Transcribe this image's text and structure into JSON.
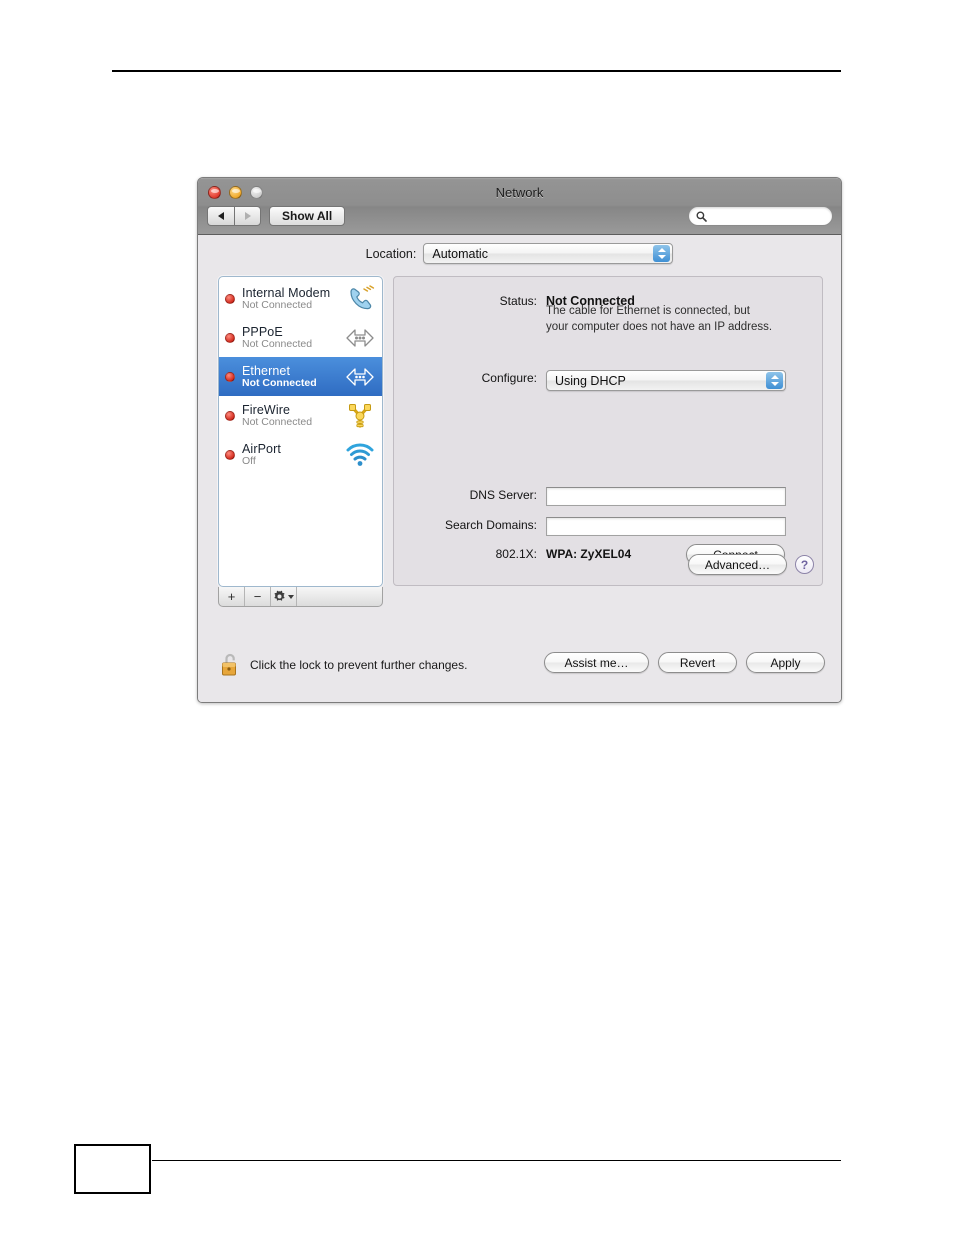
{
  "window": {
    "title": "Network",
    "traffic_lights": [
      "close-button",
      "minimize-button",
      "zoom-button"
    ],
    "toolbar": {
      "back_icon": "back-arrow-icon",
      "forward_icon": "forward-arrow-icon",
      "show_all_label": "Show All",
      "search_placeholder": "",
      "search_value": "",
      "search_icon": "search-icon"
    }
  },
  "location": {
    "label": "Location:",
    "value": "Automatic"
  },
  "sidebar": {
    "services": [
      {
        "name": "Internal Modem",
        "status": "Not Connected",
        "icon": "modem-icon",
        "selected": false
      },
      {
        "name": "PPPoE",
        "status": "Not Connected",
        "icon": "pppoe-icon",
        "selected": false
      },
      {
        "name": "Ethernet",
        "status": "Not Connected",
        "icon": "ethernet-icon",
        "selected": true
      },
      {
        "name": "FireWire",
        "status": "Not Connected",
        "icon": "firewire-icon",
        "selected": false
      },
      {
        "name": "AirPort",
        "status": "Off",
        "icon": "airport-icon",
        "selected": false
      }
    ],
    "toolbar": {
      "add_label": "+",
      "remove_label": "−",
      "action_icon": "gear-icon"
    }
  },
  "panel": {
    "status_label": "Status:",
    "status_value": "Not Connected",
    "status_note_line1": "The cable for Ethernet is connected, but",
    "status_note_line2": "your computer does not have an IP address.",
    "configure_label": "Configure:",
    "configure_value": "Using DHCP",
    "dns_label": "DNS Server:",
    "dns_value": "",
    "search_domains_label": "Search Domains:",
    "search_domains_value": "",
    "x802_label": "802.1X:",
    "x802_value": "WPA: ZyXEL04",
    "connect_label": "Connect",
    "advanced_label": "Advanced…",
    "help_label": "?"
  },
  "footer": {
    "lock_icon": "unlocked-padlock-icon",
    "lock_caption": "Click the lock to prevent further changes.",
    "assist_label": "Assist me…",
    "revert_label": "Revert",
    "apply_label": "Apply"
  },
  "colors": {
    "selection_blue": "#3a79cc",
    "status_dot_red": "#d22a1d",
    "popup_arrow_blue": "#3f8fd4",
    "sidebar_border": "#9fb8cd"
  }
}
